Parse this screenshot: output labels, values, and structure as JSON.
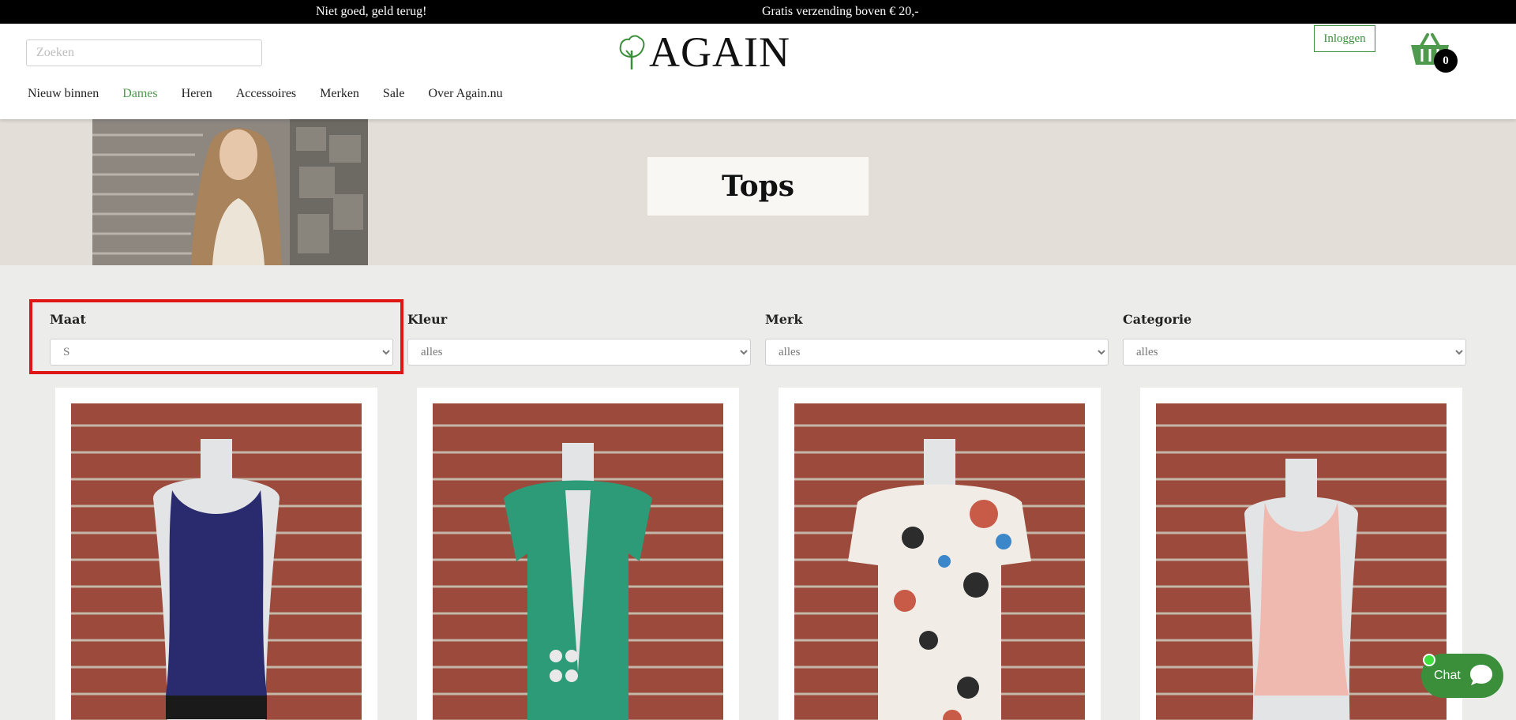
{
  "topbar": {
    "promo_left": "Niet goed, geld terug!",
    "promo_right": "Gratis verzending boven € 20,-"
  },
  "header": {
    "search_placeholder": "Zoeken",
    "logo_text": "AGAIN",
    "login_label": "Inloggen",
    "cart_count": "0",
    "icons": {
      "cart": "basket-icon",
      "logo": "tree-icon"
    }
  },
  "nav": {
    "items": [
      {
        "label": "Nieuw binnen"
      },
      {
        "label": "Dames",
        "active": true
      },
      {
        "label": "Heren"
      },
      {
        "label": "Accessoires"
      },
      {
        "label": "Merken"
      },
      {
        "label": "Sale"
      },
      {
        "label": "Over Again.nu"
      }
    ]
  },
  "hero": {
    "title": "Tops"
  },
  "filters": [
    {
      "label": "Maat",
      "value": "S"
    },
    {
      "label": "Kleur",
      "value": "alles"
    },
    {
      "label": "Merk",
      "value": "alles"
    },
    {
      "label": "Categorie",
      "value": "alles"
    }
  ],
  "products": [
    {
      "garment": "navy-camisole",
      "color": "#2a2a6e"
    },
    {
      "garment": "green-cardigan",
      "color": "#2d9a78"
    },
    {
      "garment": "floral-tee",
      "color": "#f1ede6"
    },
    {
      "garment": "pink-tank",
      "color": "#f0b9b0"
    }
  ],
  "chat": {
    "label": "Chat",
    "icon": "chat-bubble-icon"
  },
  "colors": {
    "accent": "#3b8f3b",
    "active_nav": "#4f9a4f",
    "highlight": "#e01515"
  }
}
